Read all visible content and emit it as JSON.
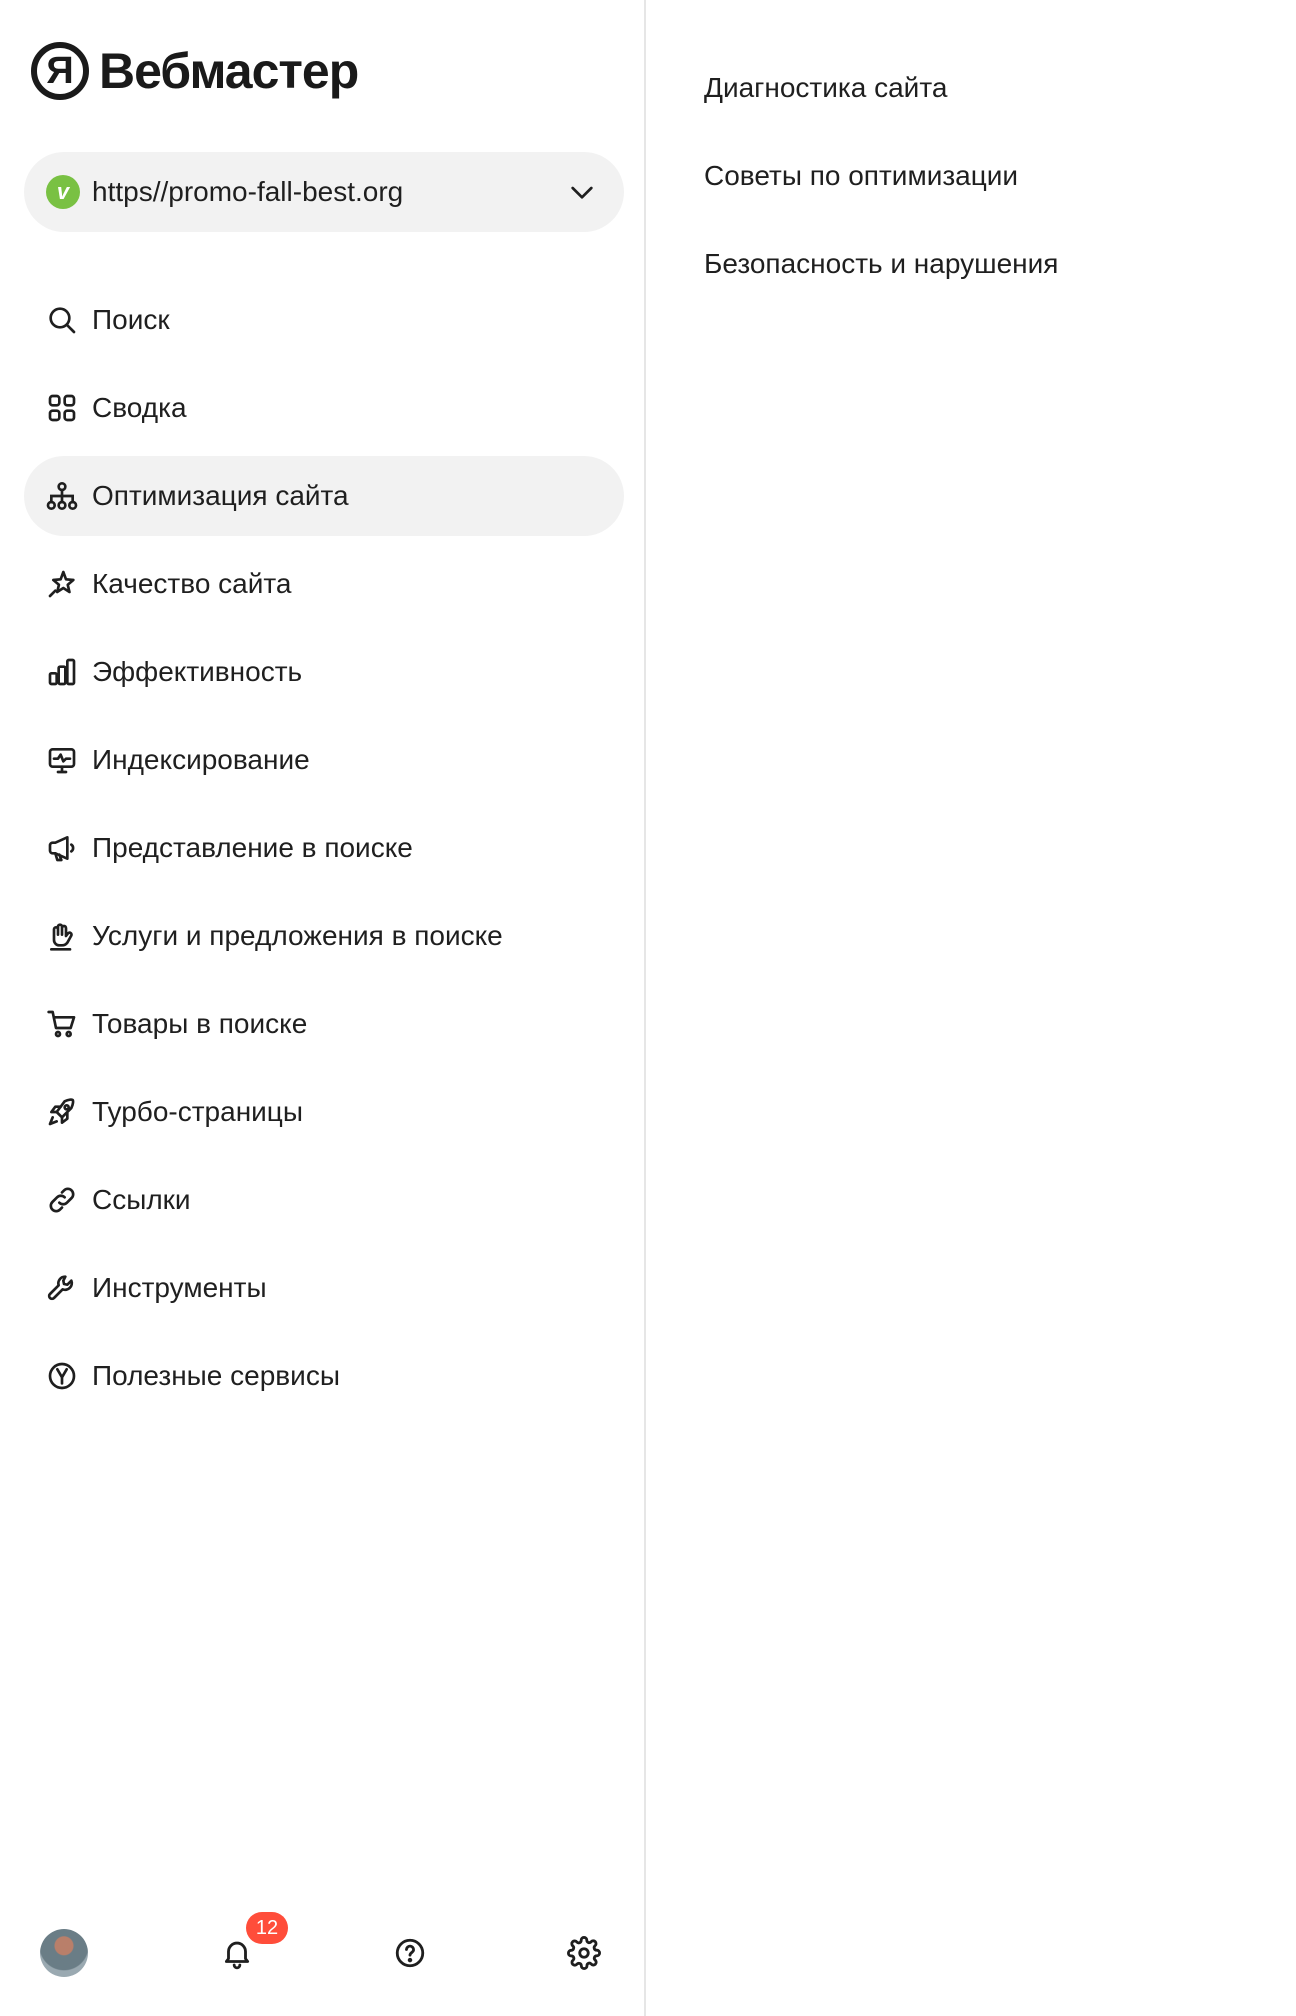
{
  "app": {
    "logo_mark": "Я",
    "logo_text": "Вебмастер"
  },
  "site_selector": {
    "favicon_letter": "v",
    "url": "https//promo-fall-best.org"
  },
  "nav": {
    "items": [
      {
        "label": "Поиск",
        "icon": "search-icon"
      },
      {
        "label": "Сводка",
        "icon": "grid-icon"
      },
      {
        "label": "Оптимизация сайта",
        "icon": "sitemap-icon",
        "active": true
      },
      {
        "label": "Качество сайта",
        "icon": "sparkle-star-icon"
      },
      {
        "label": "Эффективность",
        "icon": "bar-chart-icon"
      },
      {
        "label": "Индексирование",
        "icon": "monitor-pulse-icon"
      },
      {
        "label": "Представление в поиске",
        "icon": "megaphone-icon"
      },
      {
        "label": "Услуги и предложения в поиске",
        "icon": "hand-icon"
      },
      {
        "label": "Товары в поиске",
        "icon": "cart-icon"
      },
      {
        "label": "Турбо-страницы",
        "icon": "rocket-icon"
      },
      {
        "label": "Ссылки",
        "icon": "link-icon"
      },
      {
        "label": "Инструменты",
        "icon": "wrench-icon"
      },
      {
        "label": "Полезные сервисы",
        "icon": "yandex-services-icon"
      }
    ]
  },
  "submenu": {
    "items": [
      {
        "label": "Диагностика сайта"
      },
      {
        "label": "Советы по оптимизации"
      },
      {
        "label": "Безопасность и нарушения"
      }
    ]
  },
  "bottom_bar": {
    "notifications_count": "12"
  },
  "colors": {
    "active_bg": "#f2f2f2",
    "badge": "#ff4d3a",
    "favicon": "#79c143"
  }
}
